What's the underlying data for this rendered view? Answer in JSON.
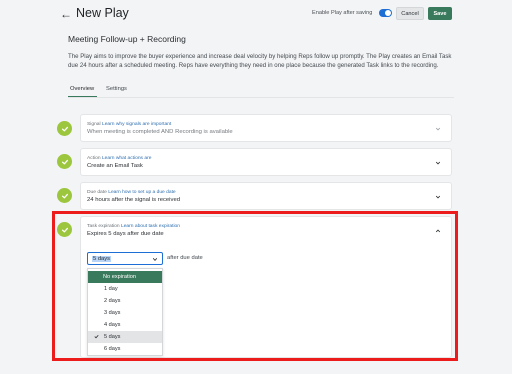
{
  "header": {
    "back_icon": "arrow-left-icon",
    "title": "New Play",
    "toggle_label": "Enable Play after saving",
    "toggle_on": true,
    "cancel_label": "Cancel",
    "save_label": "Save"
  },
  "play": {
    "title": "Meeting Follow-up + Recording",
    "description": "The Play aims to improve the buyer experience and increase deal velocity by helping Reps follow up promptly. The Play creates an Email Task due 24 hours after a scheduled meeting. Reps have everything they need in one place because the generated Task links to the recording."
  },
  "tabs": [
    {
      "label": "Overview",
      "active": true
    },
    {
      "label": "Settings",
      "active": false
    }
  ],
  "steps": [
    {
      "label": "Signal",
      "link": "Learn why signals are important",
      "value": "When meeting is completed AND Recording is available",
      "muted": true,
      "expanded": false
    },
    {
      "label": "Action",
      "link": "Learn what actions are",
      "value": "Create an Email Task",
      "muted": false,
      "expanded": false
    },
    {
      "label": "Due date",
      "link": "Learn how to set up a due date",
      "value": "24 hours after the signal is received",
      "muted": false,
      "expanded": false
    },
    {
      "label": "Task expiration",
      "link": "Learn about task expiration",
      "value": "Expires 5 days after due date",
      "muted": false,
      "expanded": true
    }
  ],
  "expiration": {
    "select_value": "5 days",
    "after_label": "after due date",
    "options": [
      "No expiration",
      "1 day",
      "2 days",
      "3 days",
      "4 days",
      "5 days",
      "6 days"
    ],
    "highlighted_option": "No expiration",
    "selected_option": "5 days"
  },
  "colors": {
    "accent_green": "#3a7a5c",
    "check_green": "#9cc63d",
    "toggle_blue": "#1d6fd6",
    "highlight_red": "#ec1c1c",
    "link_blue": "#2f6fb0"
  }
}
